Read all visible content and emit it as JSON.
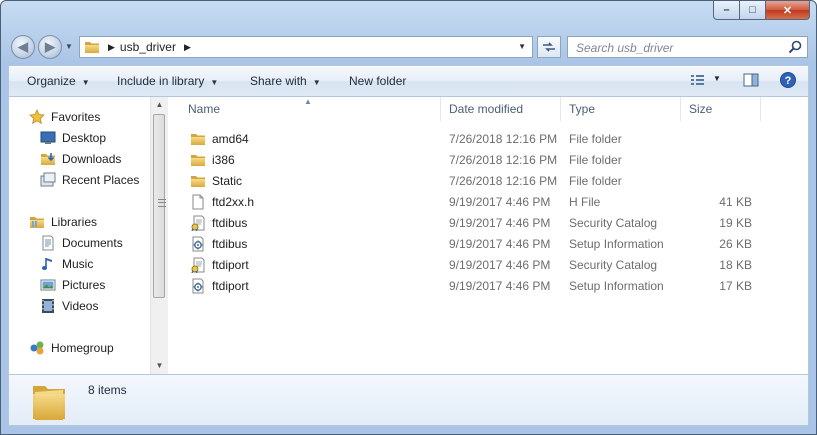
{
  "window": {
    "caption_buttons": {
      "minimize": "–",
      "maximize": "□",
      "close": "✕"
    }
  },
  "address": {
    "crumbs": [
      "usb_driver"
    ],
    "dropdown_icon": "chevron-down-icon",
    "refresh_icon": "refresh-icon"
  },
  "search": {
    "placeholder": "Search usb_driver"
  },
  "toolbar": {
    "organize": "Organize",
    "include_in_library": "Include in library",
    "share_with": "Share with",
    "new_folder": "New folder"
  },
  "nav": {
    "favorites": {
      "label": "Favorites",
      "items": [
        "Desktop",
        "Downloads",
        "Recent Places"
      ]
    },
    "libraries": {
      "label": "Libraries",
      "items": [
        "Documents",
        "Music",
        "Pictures",
        "Videos"
      ]
    },
    "homegroup": {
      "label": "Homegroup"
    }
  },
  "columns": {
    "name": "Name",
    "date": "Date modified",
    "type": "Type",
    "size": "Size"
  },
  "files": [
    {
      "name": "amd64",
      "date": "7/26/2018 12:16 PM",
      "type": "File folder",
      "size": "",
      "icon": "folder-icon"
    },
    {
      "name": "i386",
      "date": "7/26/2018 12:16 PM",
      "type": "File folder",
      "size": "",
      "icon": "folder-icon"
    },
    {
      "name": "Static",
      "date": "7/26/2018 12:16 PM",
      "type": "File folder",
      "size": "",
      "icon": "folder-icon"
    },
    {
      "name": "ftd2xx.h",
      "date": "9/19/2017 4:46 PM",
      "type": "H File",
      "size": "41 KB",
      "icon": "file-icon"
    },
    {
      "name": "ftdibus",
      "date": "9/19/2017 4:46 PM",
      "type": "Security Catalog",
      "size": "19 KB",
      "icon": "catalog-icon"
    },
    {
      "name": "ftdibus",
      "date": "9/19/2017 4:46 PM",
      "type": "Setup Information",
      "size": "26 KB",
      "icon": "setup-info-icon"
    },
    {
      "name": "ftdiport",
      "date": "9/19/2017 4:46 PM",
      "type": "Security Catalog",
      "size": "18 KB",
      "icon": "catalog-icon"
    },
    {
      "name": "ftdiport",
      "date": "9/19/2017 4:46 PM",
      "type": "Setup Information",
      "size": "17 KB",
      "icon": "setup-info-icon"
    }
  ],
  "status": {
    "item_count": "8 items"
  },
  "colors": {
    "folder": "#e8c15a",
    "title_bg": "#b9d1ec",
    "close": "#c1391c",
    "link": "#1e2b3c"
  }
}
